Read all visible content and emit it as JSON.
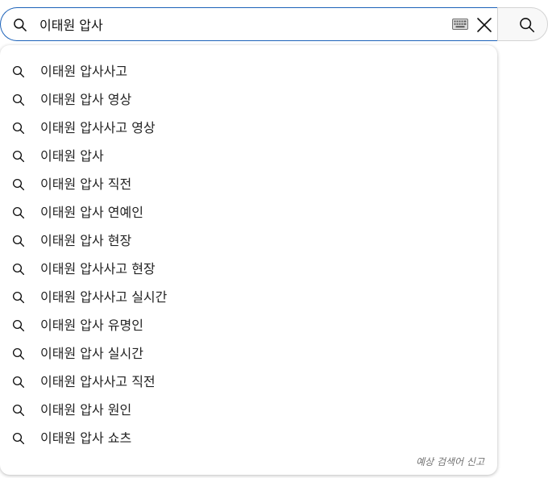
{
  "search": {
    "query": "이태원 압사",
    "icon": "search-icon"
  },
  "controls": {
    "keyboard_icon": "keyboard-icon",
    "clear_icon": "close-icon",
    "submit_icon": "search-icon"
  },
  "suggestions": [
    "이태원 압사사고",
    "이태원 압사 영상",
    "이태원 압사사고 영상",
    "이태원 압사",
    "이태원 압사 직전",
    "이태원 압사 연예인",
    "이태원 압사 현장",
    "이태원 압사사고 현장",
    "이태원 압사사고 실시간",
    "이태원 압사 유명인",
    "이태원 압사 실시간",
    "이태원 압사사고 직전",
    "이태원 압사 원인",
    "이태원 압사 쇼츠"
  ],
  "footer": {
    "report_label": "예상 검색어 신고"
  },
  "colors": {
    "focus_border": "#1c62b9",
    "text": "#222222",
    "muted": "#717171"
  }
}
